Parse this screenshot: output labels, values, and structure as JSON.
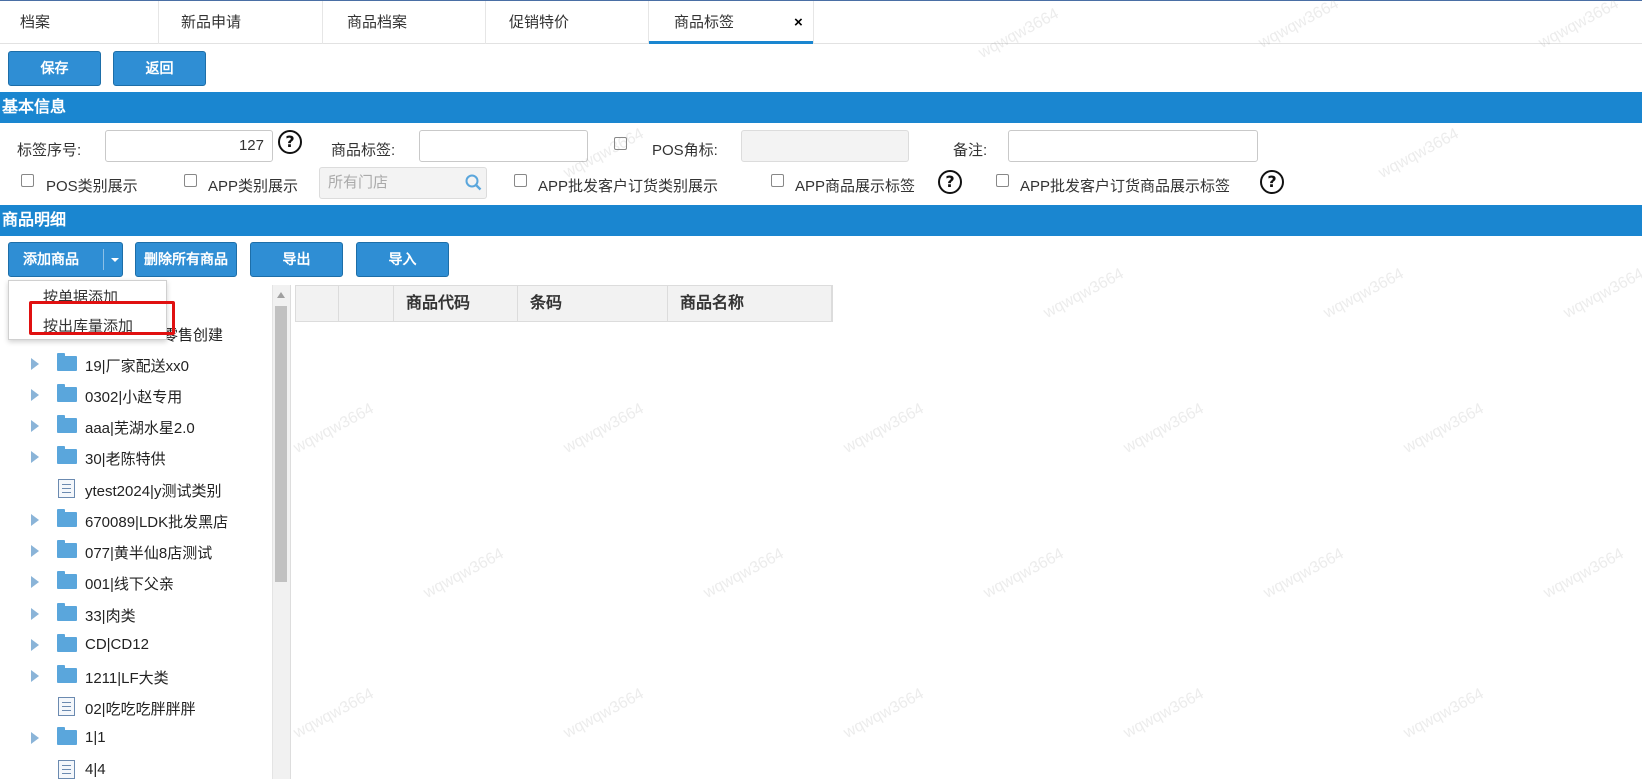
{
  "tabs": [
    {
      "label": "档案"
    },
    {
      "label": "新品申请"
    },
    {
      "label": "商品档案"
    },
    {
      "label": "促销特价"
    },
    {
      "label": "商品标签",
      "active": true
    }
  ],
  "tab_close": "×",
  "toolbar": {
    "save": "保存",
    "back": "返回"
  },
  "basic_info": {
    "title": "基本信息",
    "label_no_label": "标签序号:",
    "label_no_value": "127",
    "product_tag_label": "商品标签:",
    "product_tag_value": "",
    "pos_corner_label": "POS角标:",
    "remark_label": "备注:",
    "remark_value": "",
    "pos_category_display": "POS类别展示",
    "app_category_display": "APP类别展示",
    "store_placeholder": "所有门店",
    "app_wholesale_category": "APP批发客户订货类别展示",
    "app_product_display_tag": "APP商品展示标签",
    "app_wholesale_product_tag": "APP批发客户订货商品展示标签",
    "help_symbol": "?"
  },
  "detail": {
    "title": "商品明细",
    "add_product": "添加商品",
    "delete_all": "删除所有商品",
    "export": "导出",
    "import": "导入",
    "dropdown": [
      "按单据添加",
      "按出库量添加"
    ]
  },
  "tree": {
    "partial_item": "零售创建",
    "items": [
      {
        "label": "19|厂家配送xx0",
        "type": "folder"
      },
      {
        "label": "0302|小赵专用",
        "type": "folder"
      },
      {
        "label": "aaa|芜湖水星2.0",
        "type": "folder"
      },
      {
        "label": "30|老陈特供",
        "type": "folder"
      },
      {
        "label": "ytest2024|y测试类别",
        "type": "doc"
      },
      {
        "label": "670089|LDK批发黑店",
        "type": "folder"
      },
      {
        "label": "077|黄半仙8店测试",
        "type": "folder"
      },
      {
        "label": "001|线下父亲",
        "type": "folder"
      },
      {
        "label": "33|肉类",
        "type": "folder"
      },
      {
        "label": "CD|CD12",
        "type": "folder"
      },
      {
        "label": "1211|LF大类",
        "type": "folder"
      },
      {
        "label": "02|吃吃吃胖胖胖",
        "type": "doc"
      },
      {
        "label": "1|1",
        "type": "folder"
      },
      {
        "label": "4|4",
        "type": "doc"
      }
    ]
  },
  "grid": {
    "columns": [
      "商品代码",
      "条码",
      "商品名称"
    ]
  },
  "watermark": "wqwqw3664",
  "colors": {
    "accent": "#1a86d0",
    "button": "#2f8ed4",
    "highlight": "#e01010"
  }
}
